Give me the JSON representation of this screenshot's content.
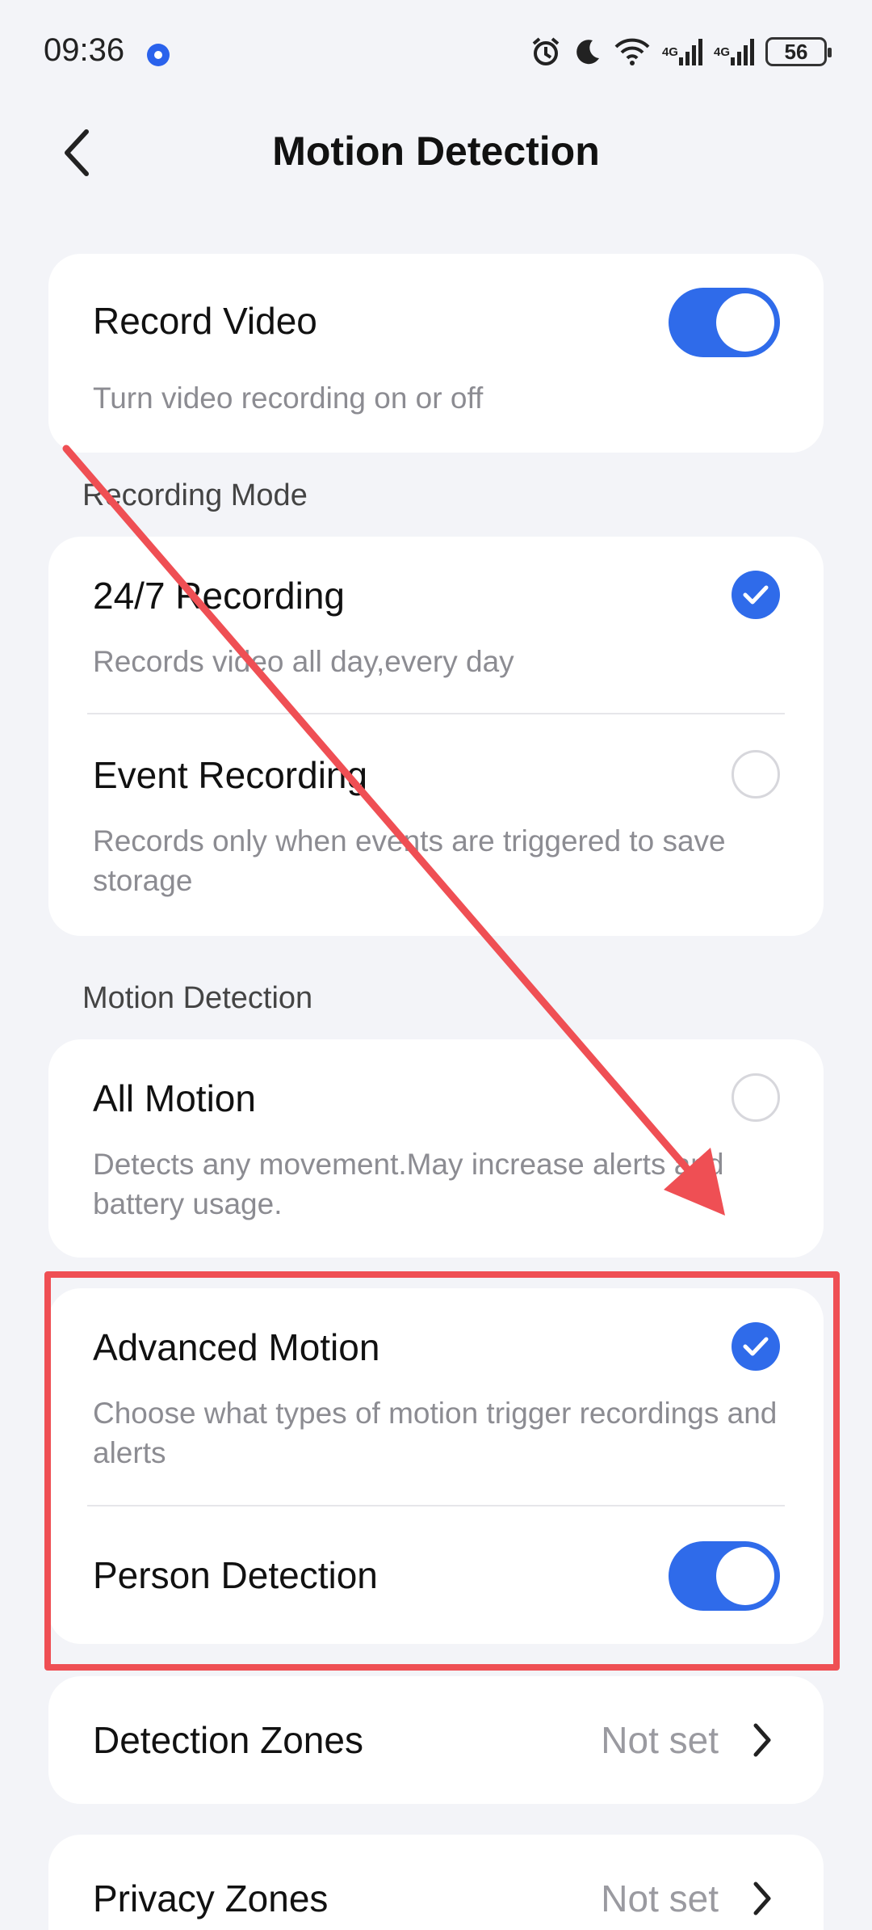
{
  "status_bar": {
    "time": "09:36",
    "battery": "56",
    "network_1": "4G",
    "network_2": "4G"
  },
  "header": {
    "title": "Motion Detection"
  },
  "record_video": {
    "title": "Record Video",
    "subtitle": "Turn video recording on or off",
    "enabled": true
  },
  "recording_mode": {
    "section_label": "Recording Mode",
    "options": [
      {
        "title": "24/7 Recording",
        "subtitle": "Records video all day,every day",
        "selected": true
      },
      {
        "title": "Event Recording",
        "subtitle": "Records only when events are triggered to save storage",
        "selected": false
      }
    ]
  },
  "motion_detection": {
    "section_label": "Motion Detection",
    "all_motion": {
      "title": "All Motion",
      "subtitle": "Detects any movement.May increase alerts and battery usage.",
      "selected": false
    },
    "advanced_motion": {
      "title": "Advanced Motion",
      "subtitle": "Choose what types of motion trigger recordings and alerts",
      "selected": true
    },
    "person_detection": {
      "title": "Person Detection",
      "enabled": true
    }
  },
  "zones": [
    {
      "title": "Detection Zones",
      "value": "Not set"
    },
    {
      "title": "Privacy Zones",
      "value": "Not set"
    }
  ],
  "colors": {
    "accent": "#2f6bea",
    "annotation": "#ef4f54",
    "background": "#f3f4f8"
  }
}
